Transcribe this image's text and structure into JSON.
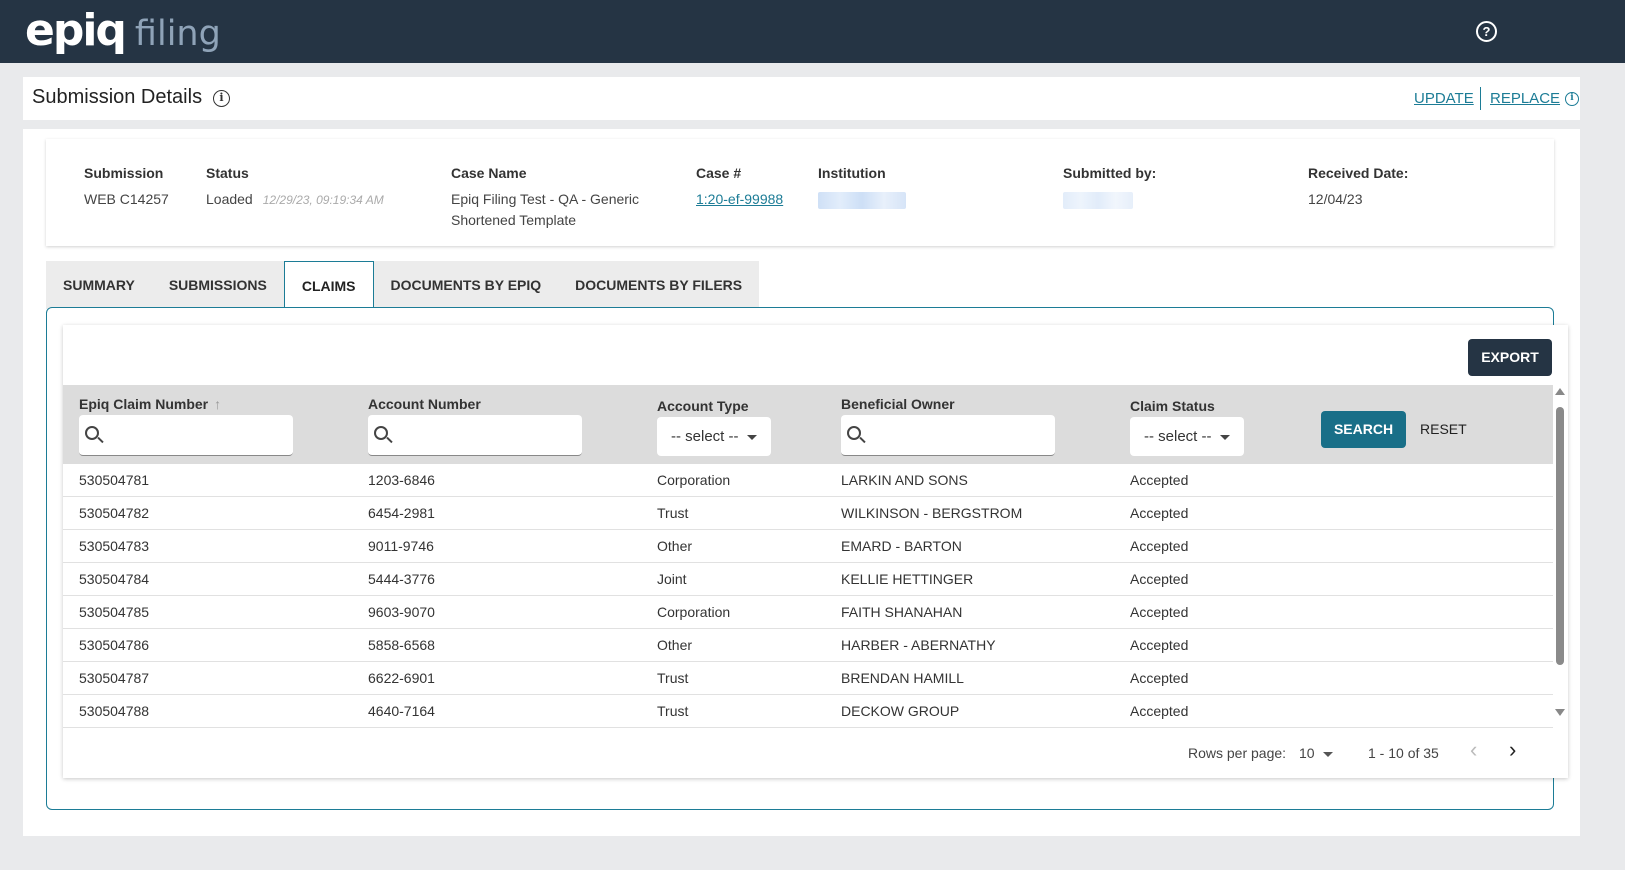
{
  "app": {
    "logo_main": "epiq",
    "logo_sub": "filing",
    "help_icon": "?"
  },
  "header": {
    "title": "Submission Details",
    "info_icon": "i",
    "update_label": "UPDATE",
    "replace_label": "REPLACE"
  },
  "details": {
    "submission_label": "Submission",
    "submission_value": "WEB C14257",
    "status_label": "Status",
    "status_value": "Loaded",
    "status_time": "12/29/23, 09:19:34 AM",
    "case_name_label": "Case Name",
    "case_name_value": "Epiq Filing Test - QA - Generic Shortened Template",
    "case_num_label": "Case #",
    "case_num_value": "1:20-ef-99988",
    "institution_label": "Institution",
    "submitted_by_label": "Submitted by:",
    "received_label": "Received Date:",
    "received_value": "12/04/23"
  },
  "tabs": [
    {
      "label": "SUMMARY",
      "active": false
    },
    {
      "label": "SUBMISSIONS",
      "active": false
    },
    {
      "label": "CLAIMS",
      "active": true
    },
    {
      "label": "DOCUMENTS BY EPIQ",
      "active": false
    },
    {
      "label": "DOCUMENTS BY FILERS",
      "active": false
    }
  ],
  "table": {
    "export_label": "EXPORT",
    "columns": [
      "Epiq Claim Number",
      "Account Number",
      "Account Type",
      "Beneficial Owner",
      "Claim Status"
    ],
    "sort_indicator": "↑",
    "select_placeholder": "-- select --",
    "search_label": "SEARCH",
    "reset_label": "RESET",
    "rows": [
      [
        "530504781",
        "1203-6846",
        "Corporation",
        "LARKIN AND SONS",
        "Accepted"
      ],
      [
        "530504782",
        "6454-2981",
        "Trust",
        "WILKINSON - BERGSTROM",
        "Accepted"
      ],
      [
        "530504783",
        "9011-9746",
        "Other",
        "EMARD - BARTON",
        "Accepted"
      ],
      [
        "530504784",
        "5444-3776",
        "Joint",
        "KELLIE HETTINGER",
        "Accepted"
      ],
      [
        "530504785",
        "9603-9070",
        "Corporation",
        "FAITH SHANAHAN",
        "Accepted"
      ],
      [
        "530504786",
        "5858-6568",
        "Other",
        "HARBER - ABERNATHY",
        "Accepted"
      ],
      [
        "530504787",
        "6622-6901",
        "Trust",
        "BRENDAN HAMILL",
        "Accepted"
      ],
      [
        "530504788",
        "4640-7164",
        "Trust",
        "DECKOW GROUP",
        "Accepted"
      ]
    ]
  },
  "pagination": {
    "rows_per_page_label": "Rows per page:",
    "rows_per_page_value": "10",
    "range": "1 - 10 of 35",
    "prev": "‹",
    "next": "›"
  },
  "colors": {
    "topbar": "#253444",
    "accent": "#1c7c96",
    "search_button": "#196f88"
  }
}
